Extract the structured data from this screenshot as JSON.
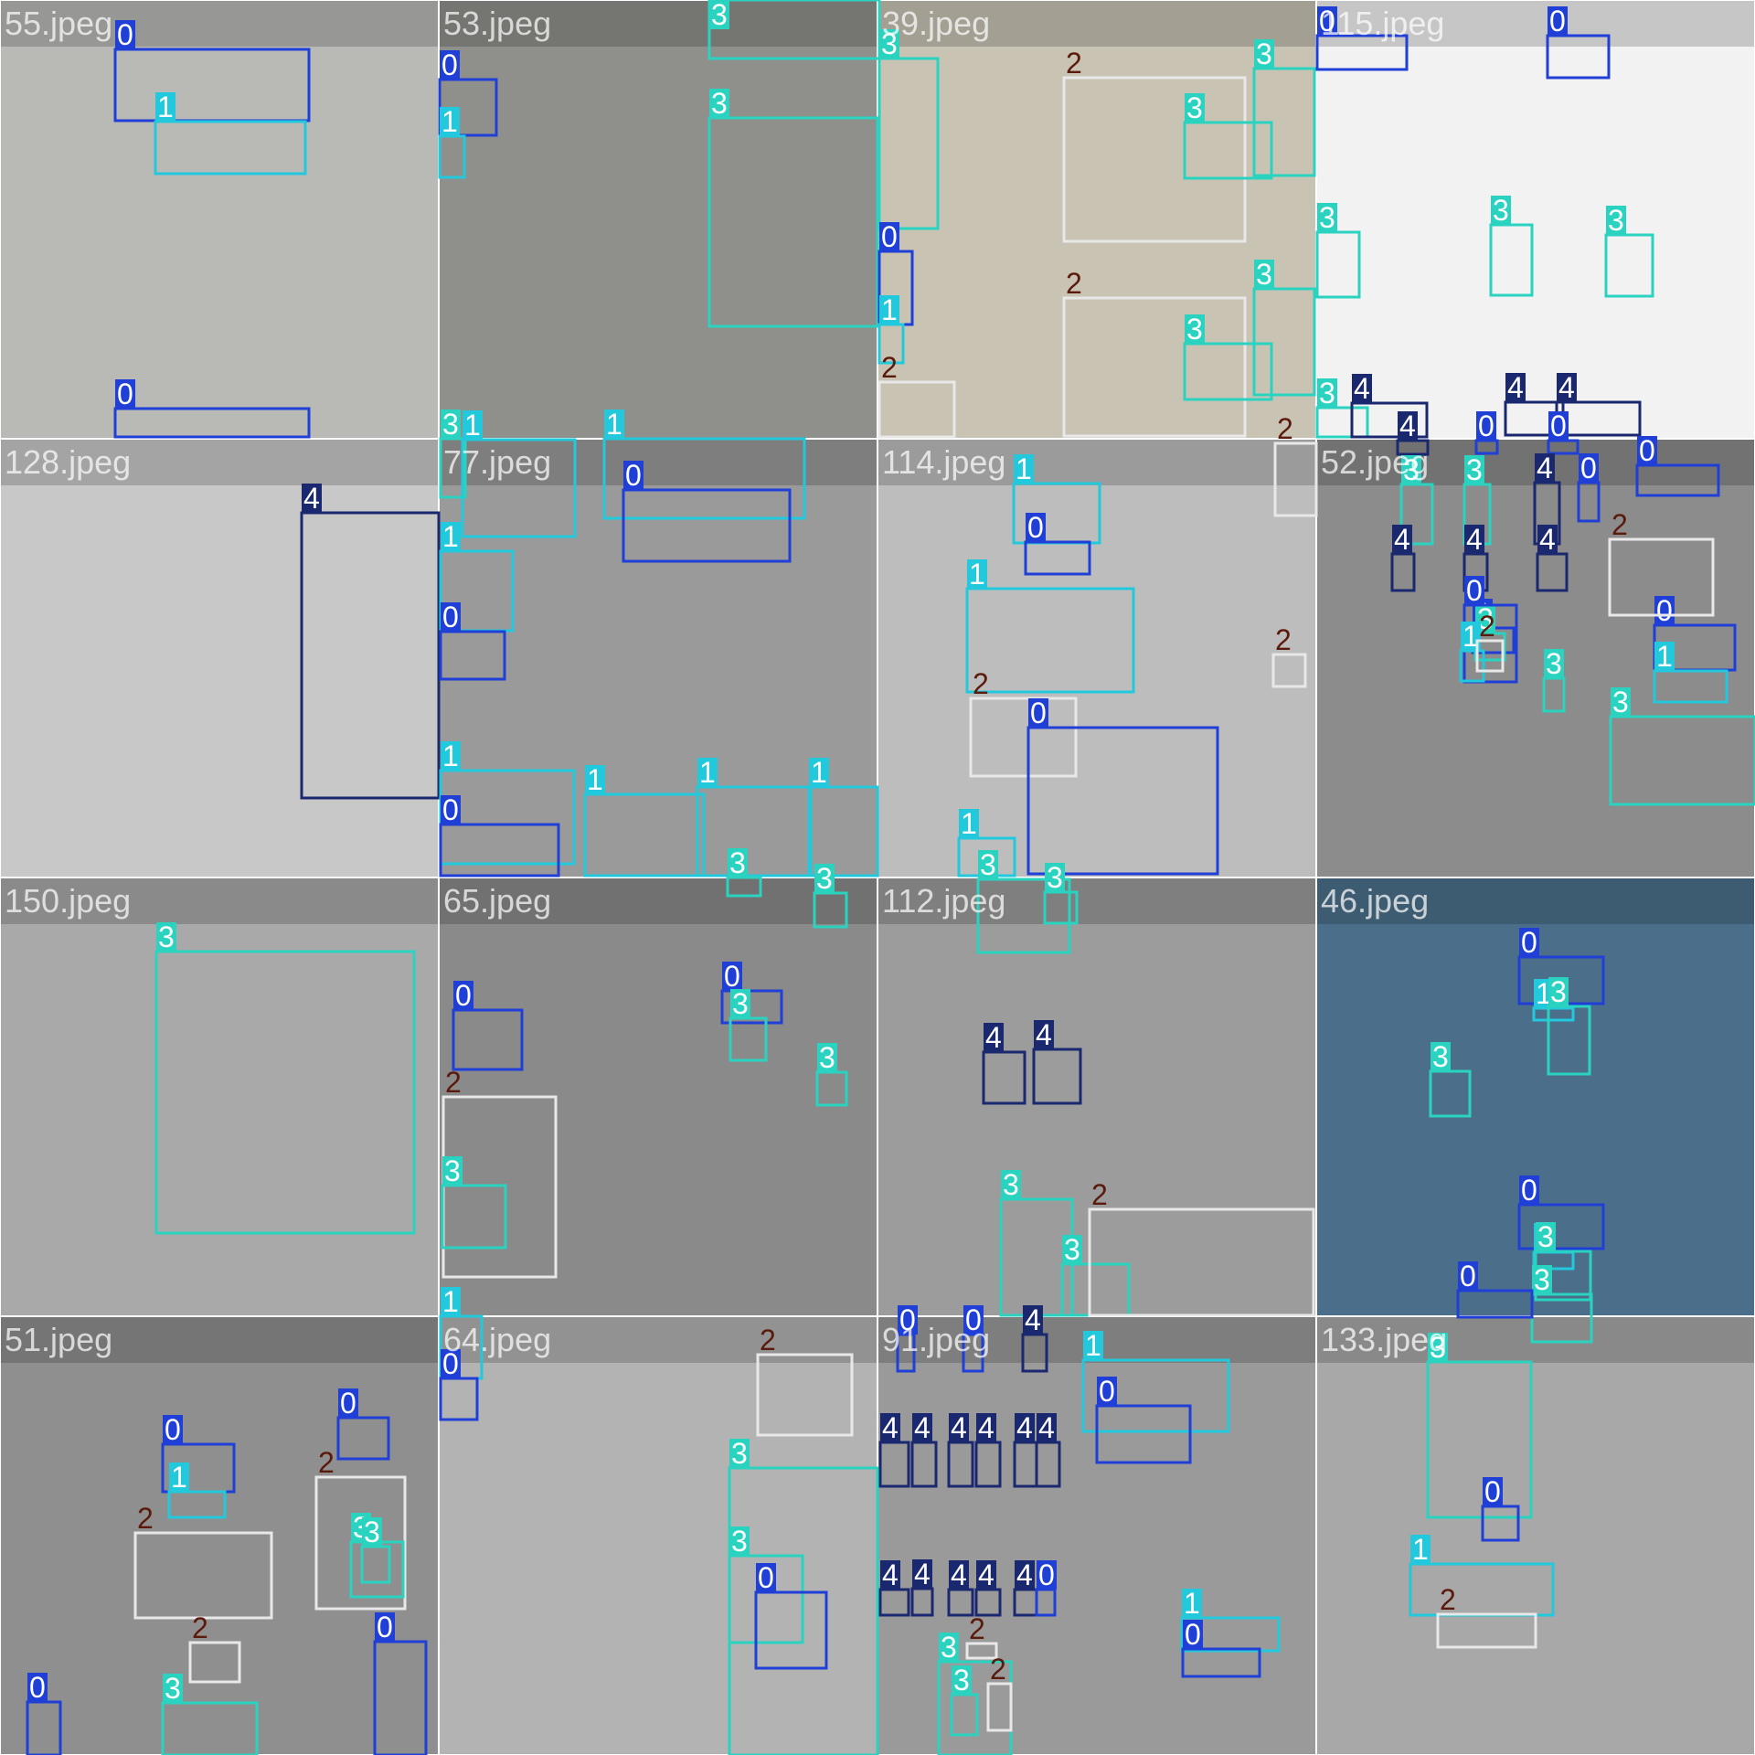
{
  "mosaic": {
    "class_colors": {
      "0": "#1f3fd6",
      "1": "#22c9dc",
      "2": "#e8e8e8",
      "3": "#2ad3c0",
      "4": "#1a2870"
    },
    "label_colors": {
      "0": {
        "bg": "#1f3fd6",
        "fg": "#ffffff"
      },
      "1": {
        "bg": "#22c9dc",
        "fg": "#ffffff"
      },
      "2": {
        "bg": "none",
        "fg": "#5a1a0c"
      },
      "3": {
        "bg": "#2ad3c0",
        "fg": "#ffffff"
      },
      "4": {
        "bg": "#1a2870",
        "fg": "#ffffff"
      }
    },
    "tiles": [
      {
        "name": "55.jpeg",
        "bg": "#b9b9b6"
      },
      {
        "name": "53.jpeg",
        "bg": "#8f8f8c"
      },
      {
        "name": "39.jpeg",
        "bg": "#c9c3b4"
      },
      {
        "name": "115.jpeg",
        "bg": "#f2f2f2"
      },
      {
        "name": "128.jpeg",
        "bg": "#c8c8c8"
      },
      {
        "name": "77.jpeg",
        "bg": "#9a9a9a"
      },
      {
        "name": "114.jpeg",
        "bg": "#bdbdbd"
      },
      {
        "name": "52.jpeg",
        "bg": "#8c8c8c"
      },
      {
        "name": "150.jpeg",
        "bg": "#a9a9a9"
      },
      {
        "name": "65.jpeg",
        "bg": "#8a8a8a"
      },
      {
        "name": "112.jpeg",
        "bg": "#9c9c9c"
      },
      {
        "name": "46.jpeg",
        "bg": "#4b6f8a"
      },
      {
        "name": "51.jpeg",
        "bg": "#8f8f8f"
      },
      {
        "name": "64.jpeg",
        "bg": "#b3b3b3"
      },
      {
        "name": "91.jpeg",
        "bg": "#9a9a9a"
      },
      {
        "name": "133.jpeg",
        "bg": "#a8a8a8"
      }
    ],
    "detections": [
      {
        "cls": "0"
      },
      {
        "cls": "1"
      },
      {
        "cls": "0"
      },
      {
        "cls": "0"
      },
      {
        "cls": "1"
      },
      {
        "cls": "3"
      },
      {
        "cls": "3"
      },
      {
        "cls": "3"
      },
      {
        "cls": "2"
      },
      {
        "cls": "3"
      },
      {
        "cls": "3"
      },
      {
        "cls": "2"
      },
      {
        "cls": "3"
      },
      {
        "cls": "3"
      },
      {
        "cls": "0"
      },
      {
        "cls": "1"
      },
      {
        "cls": "2"
      },
      {
        "cls": "0"
      },
      {
        "cls": "0"
      },
      {
        "cls": "3"
      },
      {
        "cls": "3"
      },
      {
        "cls": "3"
      },
      {
        "cls": "3"
      },
      {
        "cls": "4"
      },
      {
        "cls": "4"
      },
      {
        "cls": "4"
      },
      {
        "cls": "4"
      },
      {
        "cls": "3"
      },
      {
        "cls": "1"
      },
      {
        "cls": "1"
      },
      {
        "cls": "0"
      },
      {
        "cls": "1"
      },
      {
        "cls": "0"
      },
      {
        "cls": "1"
      },
      {
        "cls": "0"
      },
      {
        "cls": "1"
      },
      {
        "cls": "1"
      },
      {
        "cls": "1"
      },
      {
        "cls": "1"
      },
      {
        "cls": "0"
      },
      {
        "cls": "1"
      },
      {
        "cls": "2"
      },
      {
        "cls": "0"
      },
      {
        "cls": "2"
      },
      {
        "cls": "1"
      },
      {
        "cls": "2"
      },
      {
        "cls": "4"
      },
      {
        "cls": "0"
      },
      {
        "cls": "0"
      },
      {
        "cls": "0"
      },
      {
        "cls": "0"
      },
      {
        "cls": "0"
      },
      {
        "cls": "1"
      },
      {
        "cls": "2"
      },
      {
        "cls": "3"
      },
      {
        "cls": "3"
      },
      {
        "cls": "3"
      },
      {
        "cls": "4"
      },
      {
        "cls": "4"
      },
      {
        "cls": "4"
      },
      {
        "cls": "4"
      },
      {
        "cls": "0"
      },
      {
        "cls": "3"
      },
      {
        "cls": "3"
      },
      {
        "cls": "0"
      },
      {
        "cls": "1"
      },
      {
        "cls": "2"
      },
      {
        "cls": "3"
      },
      {
        "cls": "3"
      },
      {
        "cls": "3"
      },
      {
        "cls": "0"
      },
      {
        "cls": "3"
      },
      {
        "cls": "3"
      },
      {
        "cls": "0"
      },
      {
        "cls": "2"
      },
      {
        "cls": "3"
      },
      {
        "cls": "3"
      },
      {
        "cls": "3"
      },
      {
        "cls": "4"
      },
      {
        "cls": "4"
      },
      {
        "cls": "3"
      },
      {
        "cls": "3"
      },
      {
        "cls": "2"
      },
      {
        "cls": "0"
      },
      {
        "cls": "1"
      },
      {
        "cls": "3"
      },
      {
        "cls": "3"
      },
      {
        "cls": "0"
      },
      {
        "cls": "1"
      },
      {
        "cls": "3"
      },
      {
        "cls": "3"
      },
      {
        "cls": "0"
      },
      {
        "cls": "0"
      },
      {
        "cls": "1"
      },
      {
        "cls": "2"
      },
      {
        "cls": "0"
      },
      {
        "cls": "2"
      },
      {
        "cls": "3"
      },
      {
        "cls": "3"
      },
      {
        "cls": "0"
      },
      {
        "cls": "2"
      },
      {
        "cls": "3"
      },
      {
        "cls": "0"
      },
      {
        "cls": "1"
      },
      {
        "cls": "0"
      },
      {
        "cls": "2"
      },
      {
        "cls": "3"
      },
      {
        "cls": "3"
      },
      {
        "cls": "0"
      },
      {
        "cls": "0"
      },
      {
        "cls": "0"
      },
      {
        "cls": "4"
      },
      {
        "cls": "4"
      },
      {
        "cls": "4"
      },
      {
        "cls": "4"
      },
      {
        "cls": "4"
      },
      {
        "cls": "4"
      },
      {
        "cls": "4"
      },
      {
        "cls": "4"
      },
      {
        "cls": "4"
      },
      {
        "cls": "4"
      },
      {
        "cls": "4"
      },
      {
        "cls": "4"
      },
      {
        "cls": "0"
      },
      {
        "cls": "1"
      },
      {
        "cls": "0"
      },
      {
        "cls": "1"
      },
      {
        "cls": "0"
      },
      {
        "cls": "2"
      },
      {
        "cls": "3"
      },
      {
        "cls": "3"
      },
      {
        "cls": "2"
      },
      {
        "cls": "3"
      },
      {
        "cls": "0"
      },
      {
        "cls": "1"
      },
      {
        "cls": "2"
      }
    ]
  }
}
